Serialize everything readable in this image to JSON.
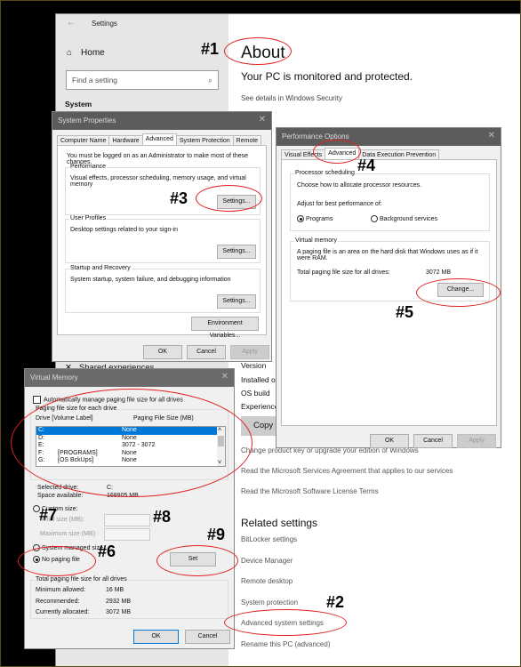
{
  "settings": {
    "title": "Settings",
    "home": "Home",
    "search_placeholder": "Find a setting",
    "section": "System",
    "about_title": "About",
    "protected": "Your PC is monitored and protected.",
    "see_details": "See details in Windows Security",
    "shared": "Shared experiences",
    "info_rows": [
      "Version",
      "Installed on",
      "OS build",
      "Experience"
    ],
    "copy": "Copy",
    "links": [
      "Change product key or upgrade your edition of Windows",
      "Read the Microsoft Services Agreement that applies to our services",
      "Read the Microsoft Software License Terms"
    ],
    "related_title": "Related settings",
    "related": [
      "BitLocker settings",
      "Device Manager",
      "Remote desktop",
      "System protection",
      "Advanced system settings",
      "Rename this PC (advanced)"
    ]
  },
  "sysprops": {
    "title": "System Properties",
    "tabs": [
      "Computer Name",
      "Hardware",
      "Advanced",
      "System Protection",
      "Remote"
    ],
    "admin_note": "You must be logged on as an Administrator to make most of these changes.",
    "performance": {
      "label": "Performance",
      "desc": "Visual effects, processor scheduling, memory usage, and virtual memory",
      "button": "Settings..."
    },
    "profiles": {
      "label": "User Profiles",
      "desc": "Desktop settings related to your sign-in",
      "button": "Settings..."
    },
    "startup": {
      "label": "Startup and Recovery",
      "desc": "System startup, system failure, and debugging information",
      "button": "Settings..."
    },
    "env_button": "Environment Variables...",
    "ok": "OK",
    "cancel": "Cancel",
    "apply": "Apply"
  },
  "perfopts": {
    "title": "Performance Options",
    "tabs": [
      "Visual Effects",
      "Advanced",
      "Data Execution Prevention"
    ],
    "sched_label": "Processor scheduling",
    "sched_desc": "Choose how to allocate processor resources.",
    "adjust": "Adjust for best performance of:",
    "programs": "Programs",
    "background": "Background services",
    "vm_label": "Virtual memory",
    "vm_desc": "A paging file is an area on the hard disk that Windows uses as if it were RAM.",
    "total_label": "Total paging file size for all drives:",
    "total_value": "3072 MB",
    "change": "Change...",
    "ok": "OK",
    "cancel": "Cancel",
    "apply": "Apply"
  },
  "vmem": {
    "title": "Virtual Memory",
    "auto_manage": "Automatically manage paging file size for all drives",
    "group_label": "Paging file size for each drive",
    "col_drive": "Drive  [Volume Label]",
    "col_size": "Paging File Size (MB)",
    "drives": [
      {
        "drive": "C:",
        "label": "",
        "size": "None"
      },
      {
        "drive": "D:",
        "label": "",
        "size": "None"
      },
      {
        "drive": "E:",
        "label": "",
        "size": "3072 - 3072"
      },
      {
        "drive": "F:",
        "label": "[PROGRAMS]",
        "size": "None"
      },
      {
        "drive": "G:",
        "label": "[OS BckUps]",
        "size": "None"
      }
    ],
    "selected_drive_label": "Selected drive:",
    "selected_drive": "C:",
    "space_label": "Space available:",
    "space": "168905 MB",
    "custom": "Custom size:",
    "initial": "Initial size (MB):",
    "maximum": "Maximum size (MB):",
    "system_managed": "System managed size",
    "no_paging": "No paging file",
    "set": "Set",
    "total_label": "Total paging file size for all drives",
    "min_label": "Minimum allowed:",
    "min": "16 MB",
    "rec_label": "Recommended:",
    "rec": "2932 MB",
    "cur_label": "Currently allocated:",
    "cur": "3072 MB",
    "ok": "OK",
    "cancel": "Cancel"
  },
  "annotations": [
    "#1",
    "#2",
    "#3",
    "#4",
    "#5",
    "#6",
    "#7",
    "#8",
    "#9"
  ],
  "icons": {
    "close": "✕",
    "back": "←",
    "home": "⌂",
    "search": "⌕",
    "scroll_up": "˄",
    "scroll_down": "˅"
  }
}
